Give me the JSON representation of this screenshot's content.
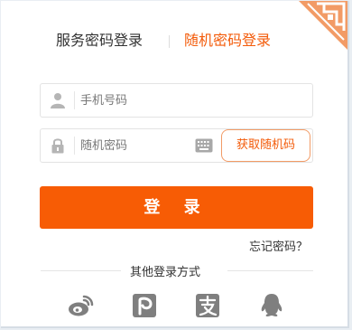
{
  "tabs": {
    "service_login": "服务密码登录",
    "random_login": "随机密码登录"
  },
  "form": {
    "phone_placeholder": "手机号码",
    "code_placeholder": "随机密码",
    "get_code_label": "获取随机码",
    "login_label": "登 录",
    "forgot_label": "忘记密码？"
  },
  "other_login": {
    "title": "其他登录方式",
    "providers": [
      "weibo-icon",
      "pay-icon",
      "alipay-icon",
      "qq-icon"
    ]
  },
  "colors": {
    "accent": "#f75c05",
    "accent_text": "#f35b0a",
    "button_border": "#f29b66",
    "icon_gray": "#8a8a8a"
  }
}
